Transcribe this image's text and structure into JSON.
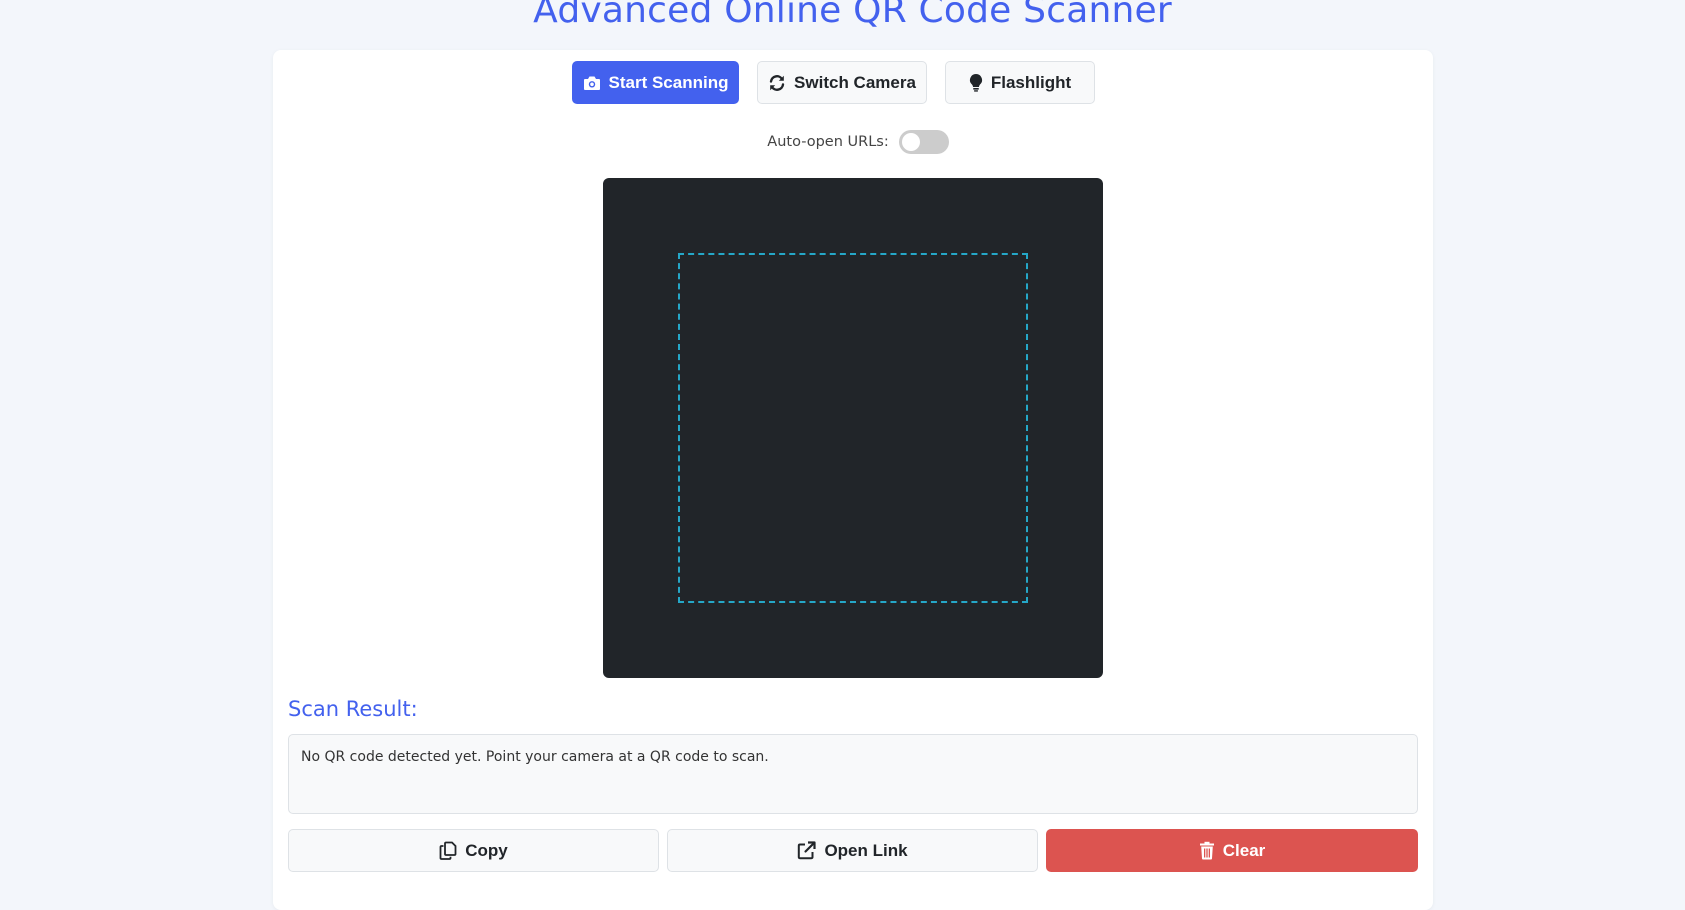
{
  "title": "Advanced Online QR Code Scanner",
  "controls": {
    "start_scanning": "Start Scanning",
    "switch_camera": "Switch Camera",
    "flashlight": "Flashlight"
  },
  "auto_open": {
    "label": "Auto-open URLs:",
    "enabled": false
  },
  "result": {
    "heading": "Scan Result:",
    "text": "No QR code detected yet. Point your camera at a QR code to scan."
  },
  "actions": {
    "copy": "Copy",
    "open_link": "Open Link",
    "clear": "Clear"
  },
  "icons": {
    "start_scanning": "camera-icon",
    "switch_camera": "sync-icon",
    "flashlight": "lightbulb-icon",
    "copy": "copy-icon",
    "open_link": "external-link-icon",
    "clear": "trash-icon"
  },
  "colors": {
    "accent": "#4361ee",
    "danger": "#dc5450",
    "video_bg": "#212529",
    "scan_frame": "#25a7c7",
    "page_bg": "#f3f6fb"
  }
}
